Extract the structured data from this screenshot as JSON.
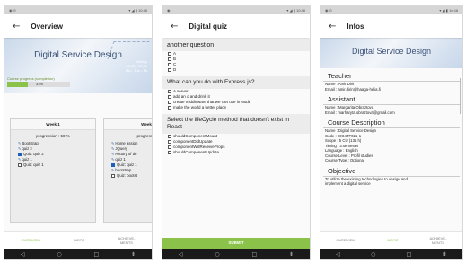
{
  "overview": {
    "title": "Overview",
    "banner_title": "Digital Service Design",
    "progress_label": "Course progress (completion)",
    "progress_value": 0.33,
    "progress_text": "33%",
    "stats": [
      "Weekly",
      "08:30 - 13:45",
      "Mo - Tue - Th"
    ],
    "week1": {
      "title": "Week 1",
      "progression": "progression : 50 %",
      "items": [
        {
          "icon": "doc",
          "text": "Bootstrap"
        },
        {
          "icon": "doc",
          "text": "quiz 2"
        },
        {
          "icon": "check-on",
          "text": "Quiz: quiz 2"
        },
        {
          "icon": "doc",
          "text": "quiz 1"
        },
        {
          "icon": "check-off",
          "text": "Quiz: quiz 1"
        }
      ]
    },
    "week2": {
      "title": "Week",
      "progression": "progressio",
      "items": [
        {
          "icon": "doc",
          "text": "Home assign"
        },
        {
          "icon": "doc",
          "text": "JQuery"
        },
        {
          "icon": "doc",
          "text": "History of de"
        },
        {
          "icon": "doc",
          "text": "quiz 1"
        },
        {
          "icon": "check-on",
          "text": "Quiz: quiz 1"
        },
        {
          "icon": "doc",
          "text": "bootstrap"
        },
        {
          "icon": "check-off",
          "text": "Quiz: bootst"
        }
      ]
    },
    "tabs": [
      "OVERVIEW",
      "INFOS",
      "ACHIEVE-\nMENTS"
    ],
    "active_tab": 0
  },
  "quiz": {
    "title": "Digital quiz",
    "q1": "another question",
    "q1_options": [
      "A",
      "B",
      "C",
      "D"
    ],
    "q2": "What can you do with Express.js?",
    "q2_options": [
      "A server",
      "add an o and drink it",
      "create middleware that we can use in Node",
      "make the world a better place"
    ],
    "q3": "Select the lifeCycle method that doesn't exist in React",
    "q3_options": [
      "shouldComponentMount",
      "componentDidUpdate",
      "componentWillReceiveProps",
      "shouldComponentUpdate"
    ],
    "submit": "SUBMIT"
  },
  "infos": {
    "title": "Infos",
    "banner_title": "Digital Service Design",
    "teacher_h": "Teacher",
    "teacher": [
      "Name : Amir Dirin",
      "Email : amir.dirin@haaga-helia.fi"
    ],
    "assistant_h": "Assistant",
    "assistant": [
      "Name : Margarita Obraztova",
      "Email : marharyta.obraztova@gmail.com"
    ],
    "course_h": "Course Description",
    "course": [
      "Name : Digital Service Design",
      "Code : DIG4TF021-1",
      "Scope : 5 CU (135 h)",
      "Timing : 3.semester",
      "Language : English",
      "Course Level : Profil studies",
      "Course Type : Optional"
    ],
    "objective_h": "Objective",
    "objective": [
      "To utilize the existing technologies to design and",
      "implement a digital service"
    ],
    "tabs": [
      "OVERVIEW",
      "INFOS",
      "ACHIEVE-\nMENTS"
    ],
    "active_tab": 1
  },
  "colors": {
    "accent": "#8bc34a",
    "brand": "#3b5278"
  },
  "nav_icons": [
    "back-triangle-icon",
    "home-circle-icon",
    "recents-square-icon",
    "menu-icon"
  ]
}
